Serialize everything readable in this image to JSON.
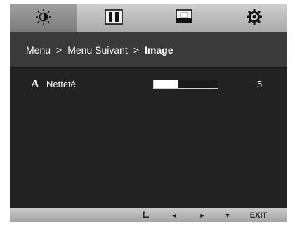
{
  "tabs": [
    {
      "icon": "brightness-icon",
      "active": true
    },
    {
      "icon": "contrast-icon",
      "active": false
    },
    {
      "icon": "monitor-icon",
      "active": false
    },
    {
      "icon": "settings-gear-icon",
      "active": false
    }
  ],
  "breadcrumb": {
    "item1": "Menu",
    "sep1": ">",
    "item2": "Menu Suivant",
    "sep2": ">",
    "current": "Image"
  },
  "settings": {
    "sharpness": {
      "icon_letter": "A",
      "label": "Netteté",
      "value": "5",
      "level_fraction": 0.38
    }
  },
  "controls": {
    "up_icon": "return-icon",
    "left_symbol": "◄",
    "right_symbol": "►",
    "down_symbol": "▼",
    "exit_label": "EXIT"
  },
  "colors": {
    "panel_bg": "#222222",
    "bar_bg": "#b8b8b8",
    "text": "#ffffff"
  }
}
